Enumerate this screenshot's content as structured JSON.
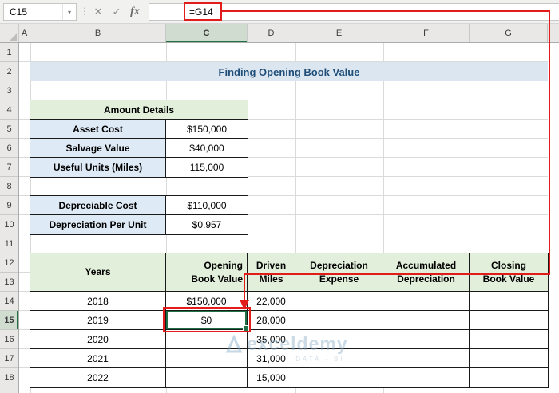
{
  "formula_bar": {
    "name_box": "C15",
    "formula": "=G14",
    "cancel_icon": "✕",
    "enter_icon": "✓",
    "fx_icon": "fx",
    "dropdown_icon": "▾",
    "divider_icon": "⋮"
  },
  "column_headers": [
    "A",
    "B",
    "C",
    "D",
    "E",
    "F",
    "G"
  ],
  "row_headers": [
    "1",
    "2",
    "3",
    "4",
    "5",
    "6",
    "7",
    "8",
    "9",
    "10",
    "11",
    "12",
    "13",
    "14",
    "15",
    "16",
    "17",
    "18"
  ],
  "title": "Finding Opening Book Value",
  "amount_details": {
    "header": "Amount Details",
    "rows": [
      {
        "label": "Asset Cost",
        "value": "$150,000"
      },
      {
        "label": "Salvage Value",
        "value": "$40,000"
      },
      {
        "label": "Useful Units (Miles)",
        "value": "115,000"
      }
    ]
  },
  "derived": {
    "rows": [
      {
        "label": "Depreciable Cost",
        "value": "$110,000"
      },
      {
        "label": "Depreciation Per Unit",
        "value": "$0.957"
      }
    ]
  },
  "main_table": {
    "headers": {
      "years": "Years",
      "opening_l1": "Opening",
      "opening_l2": "Book Value",
      "driven_l1": "Driven",
      "driven_l2": "Miles",
      "expense_l1": "Depreciation",
      "expense_l2": "Expense",
      "accum_l1": "Accumulated",
      "accum_l2": "Depreciation",
      "closing_l1": "Closing",
      "closing_l2": "Book Value"
    },
    "rows": [
      {
        "year": "2018",
        "opening": "$150,000",
        "miles": "22,000",
        "expense": "",
        "accum": "",
        "closing": ""
      },
      {
        "year": "2019",
        "opening": "$0",
        "miles": "28,000",
        "expense": "",
        "accum": "",
        "closing": ""
      },
      {
        "year": "2020",
        "opening": "",
        "miles": "35,000",
        "expense": "",
        "accum": "",
        "closing": ""
      },
      {
        "year": "2021",
        "opening": "",
        "miles": "31,000",
        "expense": "",
        "accum": "",
        "closing": ""
      },
      {
        "year": "2022",
        "opening": "",
        "miles": "15,000",
        "expense": "",
        "accum": "",
        "closing": ""
      }
    ],
    "selected_cell_ref": "C15"
  },
  "watermark": {
    "name": "exceldemy",
    "tagline": "DATA · BI"
  },
  "colors": {
    "accent_green": "#1E7145",
    "annotation_red": "#E21B1B",
    "header_green": "#E2EFDA",
    "label_blue": "#DEEAF6",
    "title_blue": "#DCE6F1",
    "title_text": "#1F4E78"
  }
}
